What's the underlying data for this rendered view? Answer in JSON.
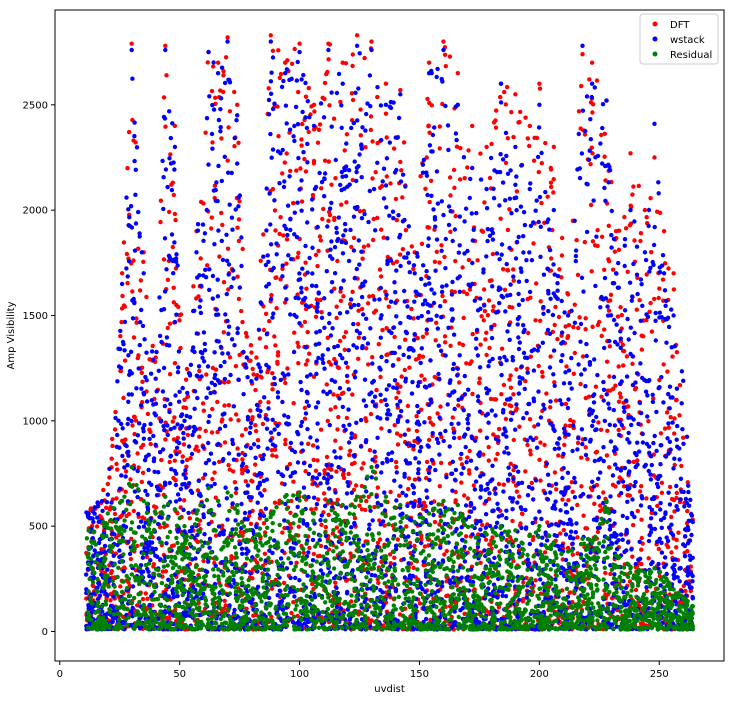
{
  "chart_data": {
    "type": "scatter",
    "xlabel": "uvdist",
    "ylabel": "Amp Visibility",
    "xlim": [
      -2,
      277
    ],
    "ylim": [
      -140,
      2950
    ],
    "x_ticks": [
      0,
      50,
      100,
      150,
      200,
      250
    ],
    "y_ticks": [
      0,
      500,
      1000,
      1500,
      2000,
      2500
    ],
    "grid": false,
    "legend_position": "top-right",
    "series": [
      {
        "name": "DFT",
        "color": "#ff0000",
        "envelope": [
          [
            12,
            560
          ],
          [
            20,
            700
          ],
          [
            26,
            1700
          ],
          [
            30,
            2790
          ],
          [
            35,
            1800
          ],
          [
            40,
            1300
          ],
          [
            44,
            2780
          ],
          [
            48,
            2400
          ],
          [
            52,
            1100
          ],
          [
            57,
            1900
          ],
          [
            62,
            2750
          ],
          [
            66,
            2700
          ],
          [
            70,
            2820
          ],
          [
            74,
            2500
          ],
          [
            78,
            1400
          ],
          [
            82,
            1300
          ],
          [
            88,
            2830
          ],
          [
            94,
            2700
          ],
          [
            100,
            2790
          ],
          [
            106,
            2500
          ],
          [
            112,
            2790
          ],
          [
            118,
            2700
          ],
          [
            124,
            2830
          ],
          [
            130,
            2800
          ],
          [
            136,
            2600
          ],
          [
            142,
            2570
          ],
          [
            148,
            1800
          ],
          [
            154,
            2700
          ],
          [
            160,
            2800
          ],
          [
            166,
            2650
          ],
          [
            172,
            2400
          ],
          [
            178,
            2300
          ],
          [
            184,
            2600
          ],
          [
            190,
            2550
          ],
          [
            196,
            2400
          ],
          [
            200,
            2600
          ],
          [
            206,
            2300
          ],
          [
            212,
            1600
          ],
          [
            218,
            2740
          ],
          [
            222,
            2700
          ],
          [
            228,
            2520
          ],
          [
            232,
            1900
          ],
          [
            238,
            2270
          ],
          [
            244,
            2000
          ],
          [
            248,
            2250
          ],
          [
            252,
            1900
          ],
          [
            256,
            1700
          ],
          [
            260,
            920
          ],
          [
            264,
            530
          ]
        ],
        "count": 2600
      },
      {
        "name": "wstack",
        "color": "#0000ff",
        "envelope": [
          [
            12,
            560
          ],
          [
            20,
            650
          ],
          [
            26,
            1650
          ],
          [
            30,
            2760
          ],
          [
            35,
            1700
          ],
          [
            40,
            1200
          ],
          [
            44,
            2760
          ],
          [
            48,
            2300
          ],
          [
            52,
            1000
          ],
          [
            57,
            1800
          ],
          [
            62,
            2750
          ],
          [
            66,
            2650
          ],
          [
            70,
            2800
          ],
          [
            74,
            2450
          ],
          [
            78,
            1300
          ],
          [
            82,
            1200
          ],
          [
            88,
            2800
          ],
          [
            94,
            2650
          ],
          [
            100,
            2750
          ],
          [
            106,
            2400
          ],
          [
            112,
            2760
          ],
          [
            118,
            2600
          ],
          [
            124,
            2780
          ],
          [
            130,
            2760
          ],
          [
            136,
            2500
          ],
          [
            142,
            2550
          ],
          [
            148,
            1700
          ],
          [
            154,
            2650
          ],
          [
            160,
            2760
          ],
          [
            166,
            2500
          ],
          [
            172,
            2200
          ],
          [
            178,
            2100
          ],
          [
            184,
            2600
          ],
          [
            190,
            2300
          ],
          [
            196,
            2100
          ],
          [
            200,
            2500
          ],
          [
            206,
            2000
          ],
          [
            212,
            1500
          ],
          [
            218,
            2780
          ],
          [
            222,
            2600
          ],
          [
            228,
            2520
          ],
          [
            232,
            1700
          ],
          [
            238,
            2000
          ],
          [
            244,
            1800
          ],
          [
            248,
            2410
          ],
          [
            252,
            1700
          ],
          [
            256,
            1500
          ],
          [
            260,
            1190
          ],
          [
            264,
            520
          ]
        ],
        "count": 3600
      },
      {
        "name": "Residual",
        "color": "#008000",
        "envelope": [
          [
            12,
            480
          ],
          [
            20,
            560
          ],
          [
            26,
            620
          ],
          [
            30,
            780
          ],
          [
            35,
            620
          ],
          [
            40,
            560
          ],
          [
            44,
            640
          ],
          [
            48,
            580
          ],
          [
            52,
            500
          ],
          [
            57,
            560
          ],
          [
            62,
            680
          ],
          [
            66,
            620
          ],
          [
            70,
            660
          ],
          [
            74,
            600
          ],
          [
            78,
            480
          ],
          [
            82,
            460
          ],
          [
            88,
            560
          ],
          [
            94,
            640
          ],
          [
            100,
            660
          ],
          [
            106,
            560
          ],
          [
            112,
            620
          ],
          [
            118,
            600
          ],
          [
            124,
            640
          ],
          [
            130,
            780
          ],
          [
            136,
            640
          ],
          [
            142,
            600
          ],
          [
            148,
            520
          ],
          [
            154,
            560
          ],
          [
            160,
            620
          ],
          [
            166,
            600
          ],
          [
            172,
            500
          ],
          [
            178,
            460
          ],
          [
            184,
            500
          ],
          [
            190,
            480
          ],
          [
            196,
            460
          ],
          [
            200,
            500
          ],
          [
            206,
            420
          ],
          [
            212,
            380
          ],
          [
            218,
            440
          ],
          [
            222,
            420
          ],
          [
            228,
            620
          ],
          [
            232,
            360
          ],
          [
            238,
            300
          ],
          [
            244,
            280
          ],
          [
            248,
            300
          ],
          [
            252,
            260
          ],
          [
            256,
            200
          ],
          [
            260,
            160
          ],
          [
            264,
            120
          ]
        ],
        "count": 2400
      }
    ]
  }
}
